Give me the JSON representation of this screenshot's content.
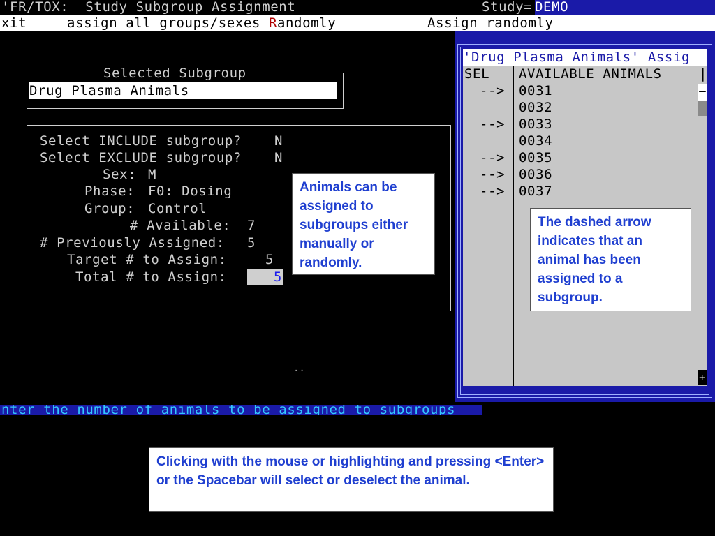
{
  "titlebar": {
    "title": "'FR/TOX:  Study Subgroup Assignment",
    "study_label": "Study=",
    "study_value": "DEMO"
  },
  "menubar": {
    "exit": "xit",
    "assign_all_prefix": "assign all groups/sexes ",
    "assign_all_hotkey": "R",
    "assign_all_suffix": "andomly",
    "assign_randomly": "Assign randomly"
  },
  "selected_subgroup": {
    "legend": "Selected Subgroup",
    "value": "Drug Plasma Animals"
  },
  "criteria": {
    "include_label": "Select INCLUDE subgroup?",
    "include_value": "N",
    "exclude_label": "Select EXCLUDE subgroup?",
    "exclude_value": "N",
    "sex_label": "Sex:",
    "sex_value": "M",
    "phase_label": "Phase:",
    "phase_value": "F0: Dosing",
    "group_label": "Group:",
    "group_value": "Control",
    "available_label": "# Available:",
    "available_value": "7",
    "prev_assigned_label": "# Previously Assigned:",
    "prev_assigned_value": "5",
    "target_label": "Target # to Assign:",
    "target_value": "5",
    "total_label": "Total # to Assign:",
    "total_value": "5"
  },
  "animal_list": {
    "title": "'Drug Plasma Animals' Assig",
    "col_sel": "SEL",
    "col_available": "AVAILABLE ANIMALS",
    "rows": [
      {
        "sel": "-->",
        "id": "0031"
      },
      {
        "sel": "",
        "id": "0032"
      },
      {
        "sel": "-->",
        "id": "0033"
      },
      {
        "sel": "",
        "id": "0034"
      },
      {
        "sel": "-->",
        "id": "0035"
      },
      {
        "sel": "-->",
        "id": "0036"
      },
      {
        "sel": "-->",
        "id": "0037"
      }
    ],
    "scroll_down_glyph": "+"
  },
  "status_bar": {
    "text": "nter the number of animals to be assigned to subgroups"
  },
  "dots": "..",
  "callouts": {
    "manual_or_random": "Animals can be assigned to subgroups either manually or randomly.",
    "dashed_arrow": "The dashed arrow indicates that an animal has been assigned to a subgroup.",
    "click_select": "Clicking with the mouse or highlighting and pressing <Enter> or the Spacebar will select or deselect the animal."
  },
  "colors": {
    "screen_bg": "#000000",
    "blue_panel": "#1a1aa8",
    "callout_text": "#1f3fd0",
    "status_text": "#33c8ff"
  }
}
